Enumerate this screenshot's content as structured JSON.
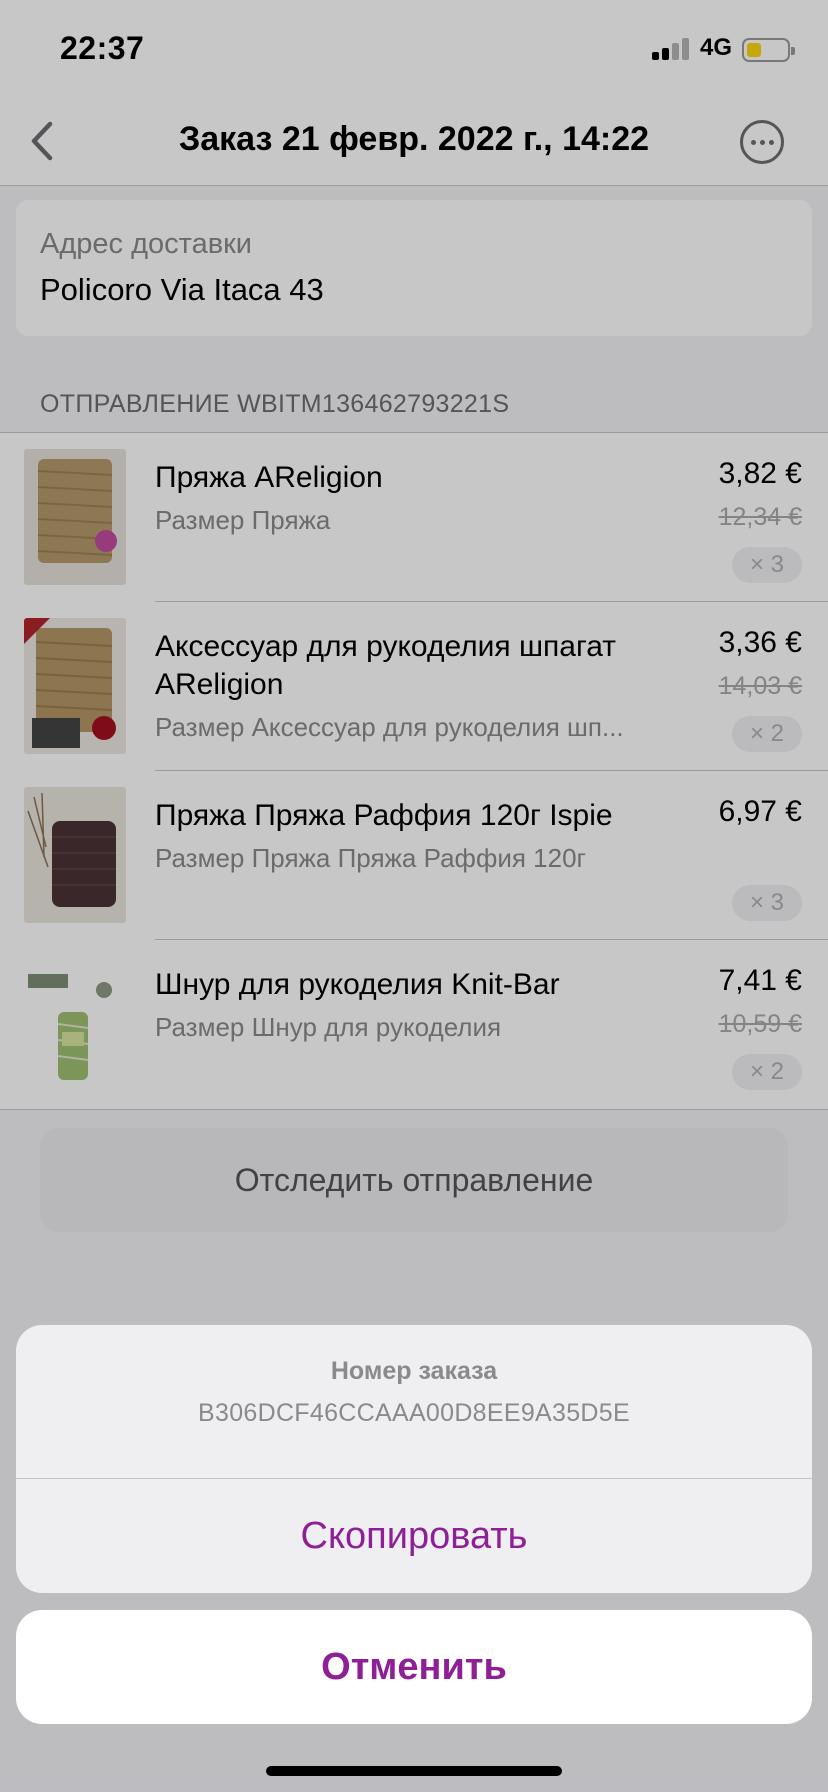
{
  "status_bar": {
    "time": "22:37",
    "network": "4G",
    "battery_icon": "battery-low-icon",
    "signal_icon": "signal-icon"
  },
  "nav": {
    "title": "Заказ 21 февр. 2022 г., 14:22",
    "back_icon": "chevron-left-icon",
    "more_icon": "ellipsis-circle-icon"
  },
  "address": {
    "label": "Адрес доставки",
    "value": "Policoro Via Itaca 43"
  },
  "shipment": {
    "label": "ОТПРАВЛЕНИЕ WBITM136462793221S"
  },
  "products": [
    {
      "name": "Пряжа AReligion",
      "size": "Размер Пряжа",
      "price": "3,82 €",
      "old_price": "12,34 €",
      "qty": "× 3"
    },
    {
      "name": "Аксессуар для рукоделия шпагат AReligion",
      "size": "Размер Аксессуар для рукоделия шп...",
      "price": "3,36 €",
      "old_price": "14,03 €",
      "qty": "× 2"
    },
    {
      "name": "Пряжа Пряжа Раффия 120г Ispie",
      "size": "Размер Пряжа Пряжа Раффия 120г",
      "price": "6,97 €",
      "old_price": "",
      "qty": "× 3"
    },
    {
      "name": "Шнур для рукоделия Knit-Bar",
      "size": "Размер Шнур для рукоделия",
      "price": "7,41 €",
      "old_price": "10,59 €",
      "qty": "× 2"
    }
  ],
  "track_button": {
    "label": "Отследить отправление"
  },
  "action_sheet": {
    "title": "Номер заказа",
    "message": "B306DCF46CCAAA00D8EE9A35D5E",
    "copy_label": "Скопировать",
    "cancel_label": "Отменить"
  },
  "colors": {
    "accent": "#8e1f96",
    "secondary_text": "#8a8a8e",
    "background": "#f2f2f7"
  }
}
